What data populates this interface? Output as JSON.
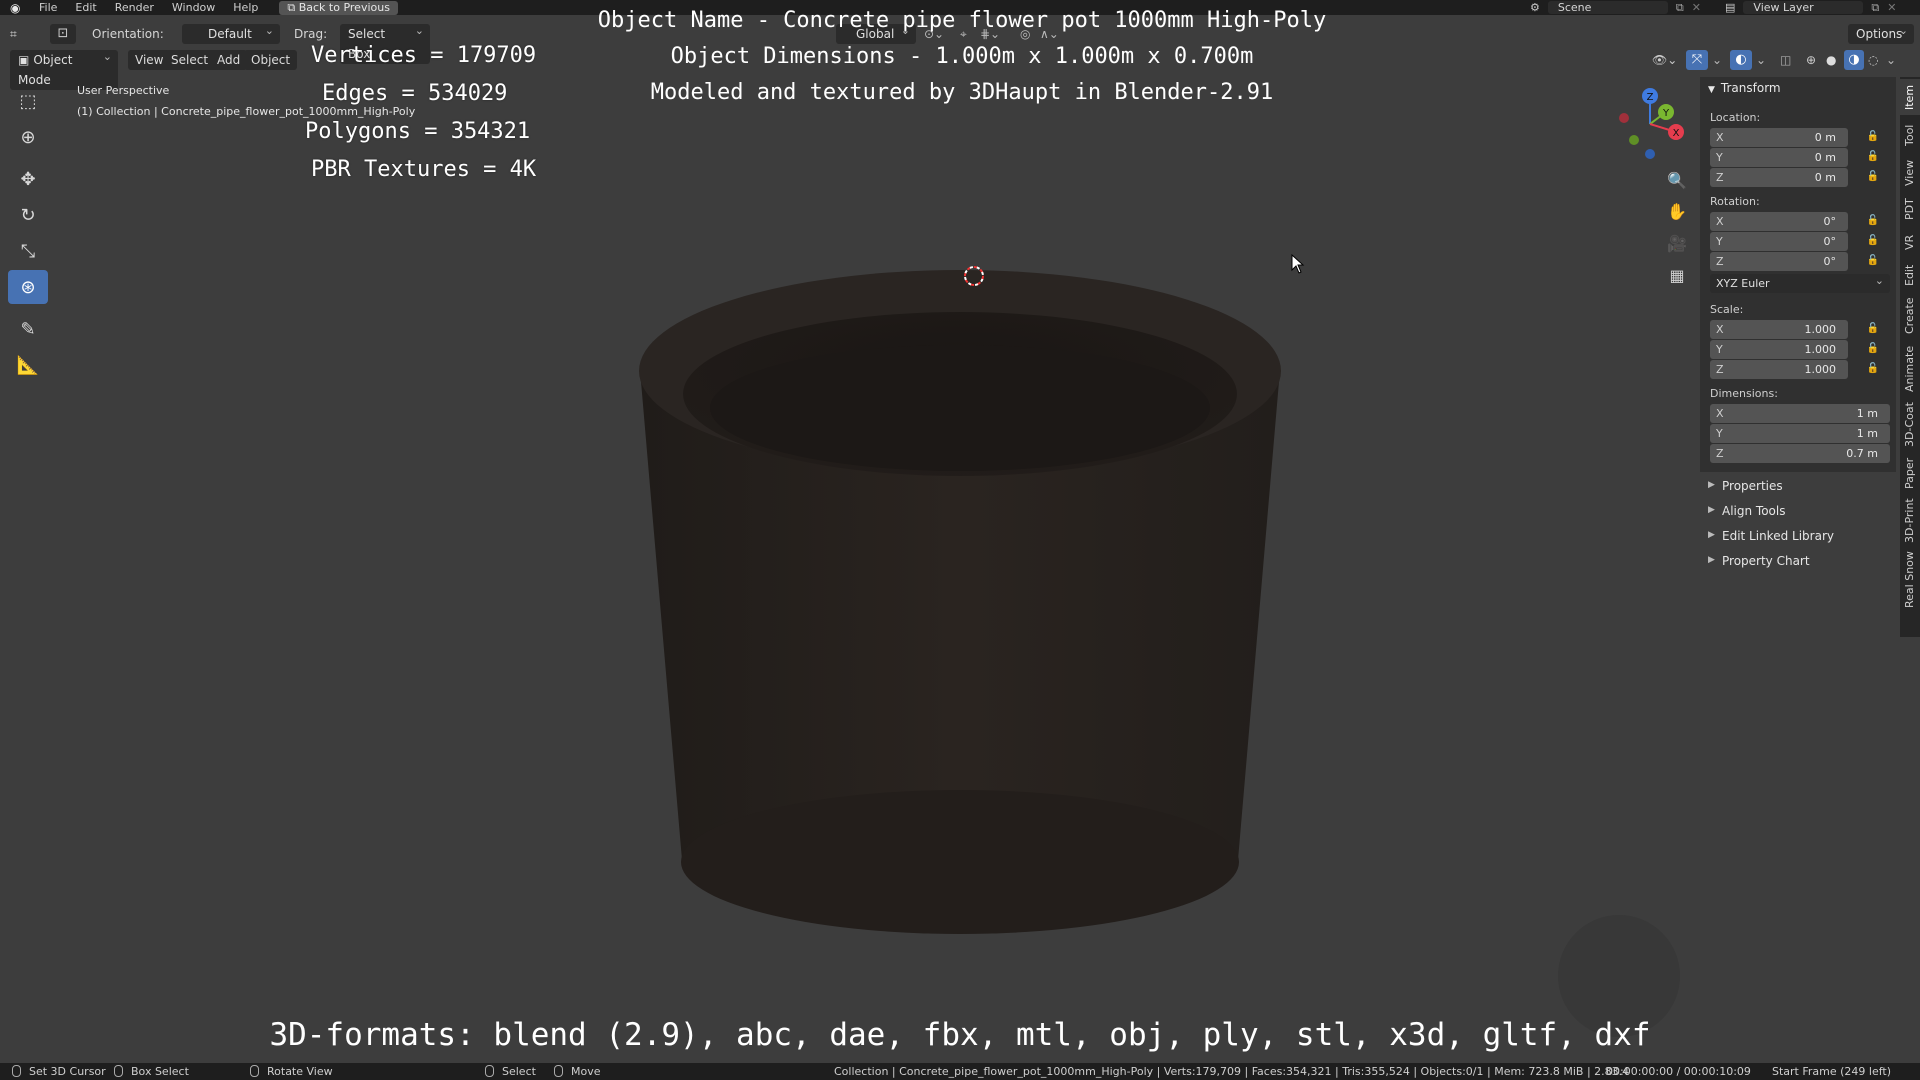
{
  "menubar": {
    "items": [
      "File",
      "Edit",
      "Render",
      "Window",
      "Help"
    ],
    "back_button": "Back to Previous",
    "scene_label": "Scene",
    "view_layer_label": "View Layer"
  },
  "header": {
    "orientation_label": "Orientation:",
    "orientation_value": "Default",
    "drag_label": "Drag:",
    "drag_value": "Select Box",
    "transform_orientation": "Global",
    "options_label": "Options",
    "mode": "Object Mode",
    "menus": [
      "View",
      "Select",
      "Add",
      "Object"
    ]
  },
  "viewport": {
    "perspective_label": "User Perspective",
    "collection_label": "(1) Collection | Concrete_pipe_flower_pot_1000mm_High-Poly",
    "stats": {
      "vertices": "Vertices = 179709",
      "edges": "Edges = 534029",
      "polygons": "Polygons = 354321",
      "textures": "PBR Textures = 4K"
    },
    "info": {
      "name_line": "Object Name - Concrete pipe flower pot 1000mm High-Poly",
      "dimensions_line": "Object Dimensions -  1.000m x 1.000m x 0.700m",
      "credit_line": "Modeled and textured by 3DHaupt in Blender-2.91"
    },
    "formats_line": "3D-formats: blend (2.9), abc, dae, fbx, mtl, obj, ply, stl, x3d, gltf, dxf",
    "gizmo_axes": {
      "x": "X",
      "y": "Y",
      "z": "Z"
    }
  },
  "npanel": {
    "title": "Transform",
    "location_label": "Location:",
    "location": [
      {
        "axis": "X",
        "value": "0 m"
      },
      {
        "axis": "Y",
        "value": "0 m"
      },
      {
        "axis": "Z",
        "value": "0 m"
      }
    ],
    "rotation_label": "Rotation:",
    "rotation": [
      {
        "axis": "X",
        "value": "0°"
      },
      {
        "axis": "Y",
        "value": "0°"
      },
      {
        "axis": "Z",
        "value": "0°"
      }
    ],
    "rotation_mode": "XYZ Euler",
    "scale_label": "Scale:",
    "scale": [
      {
        "axis": "X",
        "value": "1.000"
      },
      {
        "axis": "Y",
        "value": "1.000"
      },
      {
        "axis": "Z",
        "value": "1.000"
      }
    ],
    "dimensions_label": "Dimensions:",
    "dimensions": [
      {
        "axis": "X",
        "value": "1 m"
      },
      {
        "axis": "Y",
        "value": "1 m"
      },
      {
        "axis": "Z",
        "value": "0.7 m"
      }
    ],
    "subpanels": [
      "Properties",
      "Align Tools",
      "Edit Linked Library",
      "Property Chart"
    ]
  },
  "side_tabs": [
    "Item",
    "Tool",
    "View",
    "PDT",
    "VR",
    "Edit",
    "Create",
    "Animate",
    "3D-Coat",
    "Paper",
    "3D-Print",
    "Real Snow"
  ],
  "statusbar": {
    "set_cursor": "Set 3D Cursor",
    "box_select": "Box Select",
    "rotate_view": "Rotate View",
    "select": "Select",
    "move": "Move",
    "info": "Collection | Concrete_pipe_flower_pot_1000mm_High-Poly | Verts:179,709 | Faces:354,321 | Tris:355,524 | Objects:0/1 | Mem: 723.8 MiB | 2.83.4",
    "timecode": "00:00:00:00 / 00:00:10:09",
    "frame": "Start Frame (249 left)"
  },
  "colors": {
    "background": "#3d3d3d",
    "panel": "#303030",
    "accent": "#4772b3",
    "pot": "#26211d",
    "axis_x": "#e53d4e",
    "axis_y": "#7ab730",
    "axis_z": "#3f7be0"
  }
}
